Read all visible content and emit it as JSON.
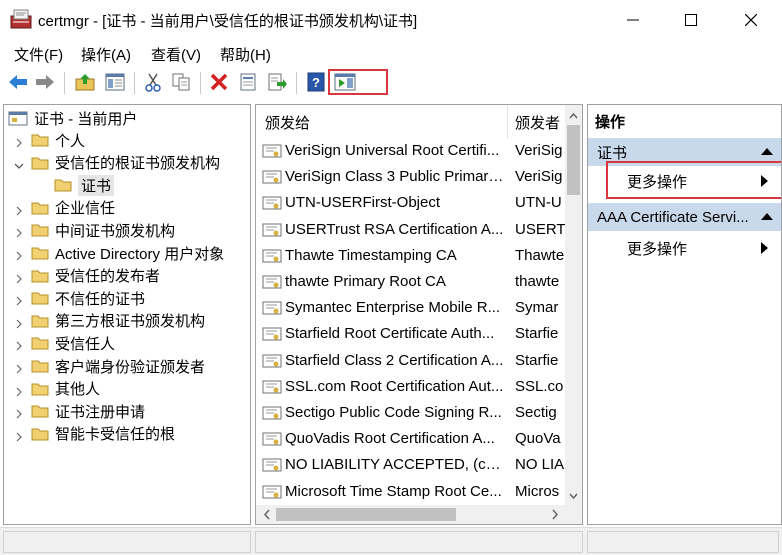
{
  "window": {
    "title": "certmgr - [证书 - 当前用户\\受信任的根证书颁发机构\\证书]",
    "icon": "certmgr-app-icon"
  },
  "menu": [
    "文件(F)",
    "操作(A)",
    "查看(V)",
    "帮助(H)"
  ],
  "toolbar": {
    "icons": [
      "back-arrow-icon",
      "forward-arrow-icon",
      "up-folder-icon",
      "show-hide-console-tree-icon",
      "cut-icon",
      "copy-icon",
      "delete-icon",
      "properties-icon",
      "export-list-icon",
      "help-icon",
      "show-hide-action-pane-icon"
    ],
    "highlight_color": "#d9363e"
  },
  "tree": {
    "root": "证书 - 当前用户",
    "items": [
      {
        "label": "个人",
        "expanded": false
      },
      {
        "label": "受信任的根证书颁发机构",
        "expanded": true
      },
      {
        "label": "证书",
        "selected": true
      },
      {
        "label": "企业信任",
        "expanded": false
      },
      {
        "label": "中间证书颁发机构",
        "expanded": false
      },
      {
        "label": "Active Directory 用户对象",
        "expanded": false
      },
      {
        "label": "受信任的发布者",
        "expanded": false
      },
      {
        "label": "不信任的证书",
        "expanded": false
      },
      {
        "label": "第三方根证书颁发机构",
        "expanded": false
      },
      {
        "label": "受信任人",
        "expanded": false
      },
      {
        "label": "客户端身份验证颁发者",
        "expanded": false
      },
      {
        "label": "其他人",
        "expanded": false
      },
      {
        "label": "证书注册申请",
        "expanded": false
      },
      {
        "label": "智能卡受信任的根",
        "expanded": false
      }
    ]
  },
  "list": {
    "columns": [
      "颁发给",
      "颁发者"
    ],
    "rows": [
      {
        "issued_to": "VeriSign Universal Root Certifi...",
        "issuer": "VeriSig"
      },
      {
        "issued_to": "VeriSign Class 3 Public Primary...",
        "issuer": "VeriSig"
      },
      {
        "issued_to": "UTN-USERFirst-Object",
        "issuer": "UTN-U"
      },
      {
        "issued_to": "USERTrust RSA Certification A...",
        "issuer": "USERT"
      },
      {
        "issued_to": "Thawte Timestamping CA",
        "issuer": "Thawte"
      },
      {
        "issued_to": "thawte Primary Root CA",
        "issuer": "thawte"
      },
      {
        "issued_to": "Symantec Enterprise Mobile R...",
        "issuer": "Symar"
      },
      {
        "issued_to": "Starfield Root Certificate Auth...",
        "issuer": "Starfie"
      },
      {
        "issued_to": "Starfield Class 2 Certification A...",
        "issuer": "Starfie"
      },
      {
        "issued_to": "SSL.com Root Certification Aut...",
        "issuer": "SSL.co"
      },
      {
        "issued_to": "Sectigo Public Code Signing R...",
        "issuer": "Sectig"
      },
      {
        "issued_to": "QuoVadis Root Certification A...",
        "issuer": "QuoVa"
      },
      {
        "issued_to": "NO LIABILITY ACCEPTED, (c)9...",
        "issuer": "NO LIA"
      },
      {
        "issued_to": "Microsoft Time Stamp Root Ce...",
        "issuer": "Micros"
      }
    ]
  },
  "actions": {
    "header": "操作",
    "sections": [
      {
        "title": "证书",
        "items": [
          "更多操作"
        ]
      },
      {
        "title": "AAA Certificate Servi...",
        "items": [
          "更多操作"
        ]
      }
    ],
    "section_color": "#c9d9ec"
  }
}
